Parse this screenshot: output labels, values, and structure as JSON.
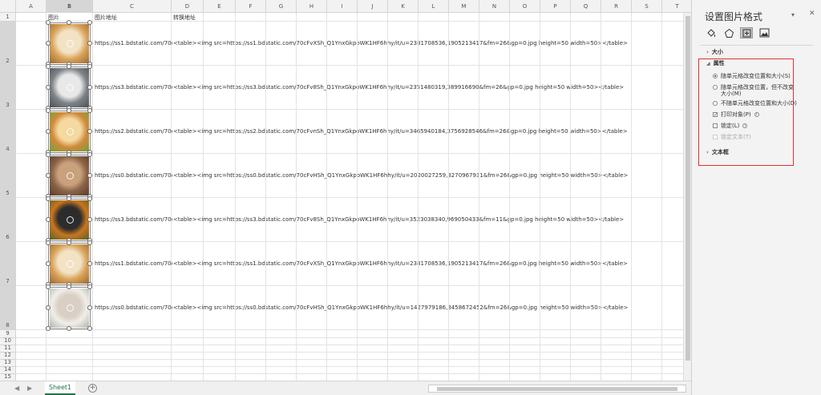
{
  "sheet": {
    "columns": [
      "A",
      "B",
      "C",
      "D",
      "E",
      "F",
      "G",
      "H",
      "I",
      "J",
      "K",
      "L",
      "M",
      "N",
      "O",
      "P",
      "Q",
      "R",
      "S",
      "T"
    ],
    "selected_column": "B",
    "rows": [
      "1",
      "2",
      "3",
      "4",
      "5",
      "6",
      "7",
      "8",
      "9",
      "10",
      "11",
      "12",
      "13",
      "14",
      "15",
      "16"
    ],
    "selected_rows": [
      "2",
      "3",
      "4",
      "5",
      "6",
      "7",
      "8"
    ],
    "header_row": {
      "b": "图片",
      "c": "图片地址",
      "d": "转换地址"
    },
    "data_rows": [
      {
        "url": "https://ss1.bdstatic.com/70c",
        "converted": "<table><img src=https://ss1.bdstatic.com/70cFvXSh_Q1YnxGkpoWK1HF6hhy/it/u=2381708536,1905213417&fm=26&gp=0.jpg height=50 width=50></table>",
        "pic": "cat-orange-white"
      },
      {
        "url": "https://ss3.bdstatic.com/70c",
        "converted": "<table><img src=https://ss3.bdstatic.com/70cFv8Sh_Q1YnxGkpoWK1HF6hhy/it/u=2351480319,389916690&fm=26&gp=0.jpg height=50 width=50></table>",
        "pic": "cat-grey-white"
      },
      {
        "url": "https://ss2.bdstatic.com/70c",
        "converted": "<table><img src=https://ss2.bdstatic.com/70cFvnSh_Q1YnxGkpoWK1HF6hhy/it/u=3465940184,3756928546&fm=26&gp=0.jpg height=50 width=50></table>",
        "pic": "dog-shiba"
      },
      {
        "url": "https://ss0.bdstatic.com/70c",
        "converted": "<table><img src=https://ss0.bdstatic.com/70cFvHSh_Q1YnxGkpoWK1HF6hhy/it/u=2020027259,3270967931&fm=26&gp=0.jpg height=50 width=50></table>",
        "pic": "cat-brown"
      },
      {
        "url": "https://ss3.bdstatic.com/70c",
        "converted": "<table><img src=https://ss3.bdstatic.com/70cFv8Sh_Q1YnxGkpoWK1HF6hhy/it/u=3523038340,969050433&fm=11&gp=0.jpg height=50 width=50></table>",
        "pic": "tiger"
      },
      {
        "url": "https://ss1.bdstatic.com/70c",
        "converted": "<table><img src=https://ss1.bdstatic.com/70cFvXSh_Q1YnxGkpoWK1HF6hhy/it/u=2381708536,1905213417&fm=26&gp=0.jpg height=50 width=50></table>",
        "pic": "cat-orange-white"
      },
      {
        "url": "https://ss0.bdstatic.com/70c",
        "converted": "<table><img src=https://ss0.bdstatic.com/70cFvHSh_Q1YnxGkpoWK1HF6hhy/it/u=1427979186,3458672452&fm=26&gp=0.jpg height=50 width=50></table>",
        "pic": "kitten-white"
      }
    ],
    "sheet_tab": "Sheet1"
  },
  "pane": {
    "title": "设置图片格式",
    "sections": {
      "size": "大小",
      "properties": "属性",
      "textbox": "文本框"
    },
    "options": {
      "move_and_size": "随单元格改变位置和大小(S)",
      "move_no_size": "随单元格改变位置，但不改变大小(M)",
      "no_move_no_size": "不随单元格改变位置和大小(D)",
      "print_object": "打印对象(P)",
      "locked": "锁定(L)",
      "lock_text": "锁定文本(T)"
    },
    "selected_option": "move_and_size",
    "print_object_checked": true,
    "locked_checked": false
  }
}
